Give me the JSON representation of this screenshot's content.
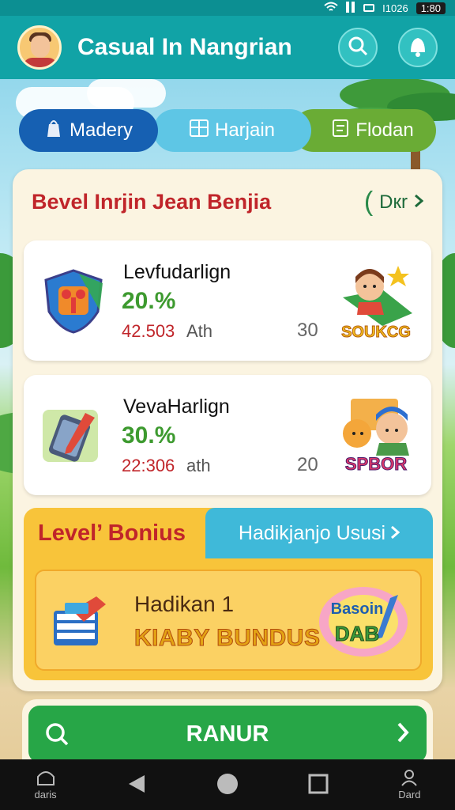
{
  "status_bar": {
    "time_left": "I1026",
    "time_right": "1:80"
  },
  "header": {
    "title": "Casual In Nangrian",
    "search_icon": "search-icon",
    "profile_icon": "user-bell-icon"
  },
  "tabs": [
    {
      "label": "Madery",
      "icon": "bag-icon",
      "active": true
    },
    {
      "label": "Harjain",
      "icon": "grid-icon",
      "active": false
    },
    {
      "label": "Flodan",
      "icon": "clipboard-icon",
      "active": false
    }
  ],
  "panel": {
    "title": "Bevel Inrjin Jean Benjia",
    "link_label": "Dкr",
    "items": [
      {
        "name": "Levfudarlign",
        "percent": "20.%",
        "score": "42.503",
        "unit": "Ath",
        "count": "30",
        "badge_text": "SOUKCG"
      },
      {
        "name": "VevaHarlign",
        "percent": "30.%",
        "score": "22:306",
        "unit": "ath",
        "count": "20",
        "badge_text": "SPBOR"
      }
    ]
  },
  "bonus": {
    "tab_label": "Level’ Bonius",
    "link_label": "Hadikjanjo Ususi",
    "name": "Hadikan 1",
    "subtitle": "KIABY BUNDUS",
    "badge_line1": "Basoin",
    "badge_line2": "DAB"
  },
  "run_button": {
    "label": "RANUR"
  },
  "nav": {
    "home_label": "daris",
    "profile_label": "Dard"
  },
  "colors": {
    "header": "#11a3a6",
    "tab_active": "#1660b2",
    "accent_red": "#c0252a",
    "green": "#27a647",
    "bonus": "#f8c43a"
  }
}
